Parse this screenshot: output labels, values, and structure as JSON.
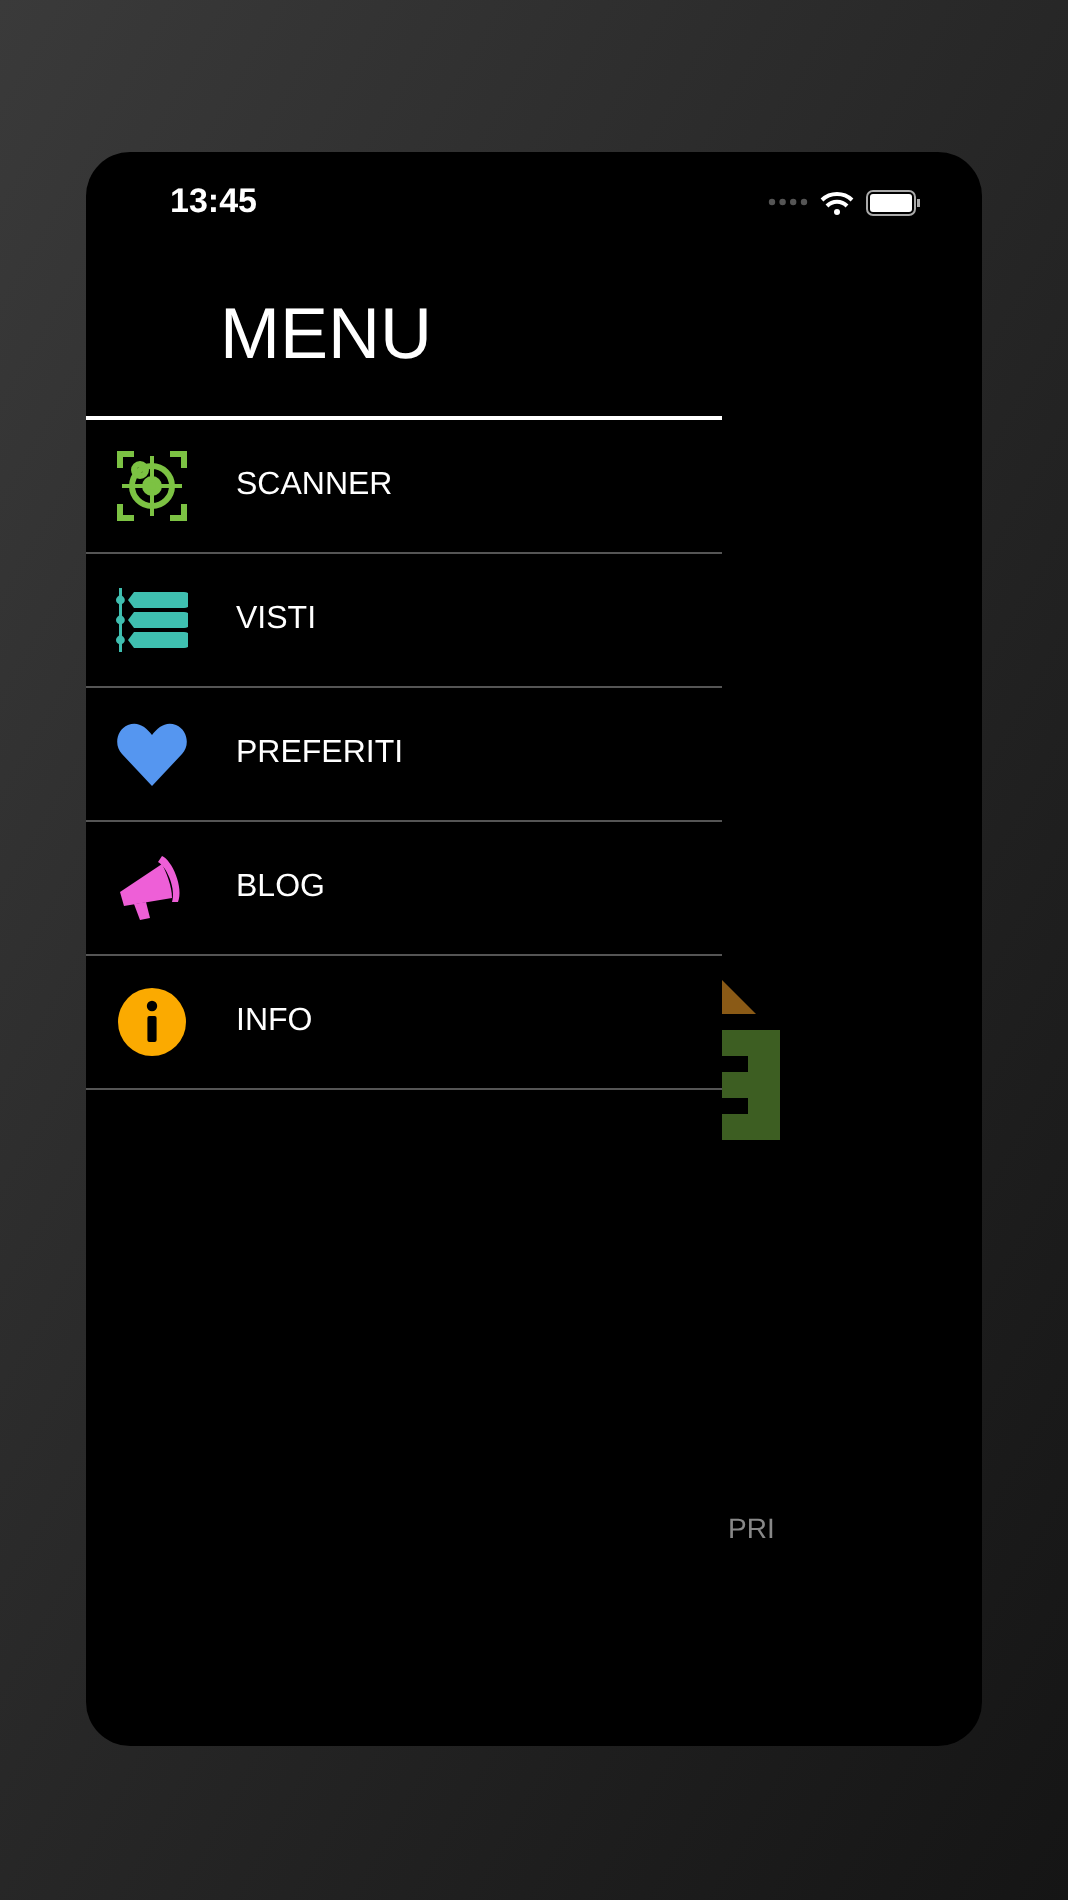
{
  "status_bar": {
    "time": "13:45"
  },
  "menu": {
    "title": "MENU",
    "items": [
      {
        "label": "SCANNER",
        "kind": "target",
        "color": "#7cc243"
      },
      {
        "label": "VISTI",
        "kind": "list",
        "color": "#3fbfb0"
      },
      {
        "label": "PREFERITI",
        "kind": "heart",
        "color": "#5596f0"
      },
      {
        "label": "BLOG",
        "kind": "megaphone",
        "color": "#ee5fd7"
      },
      {
        "label": "INFO",
        "kind": "info",
        "color": "#fbaa00"
      }
    ]
  },
  "background_page": {
    "button_label": "PRI"
  }
}
